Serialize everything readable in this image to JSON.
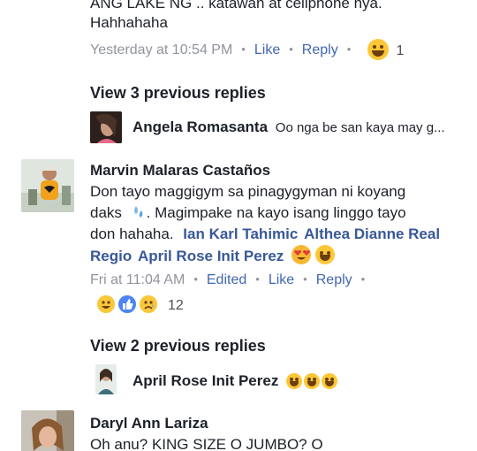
{
  "comment_top": {
    "text_line1": "ANG LAKE NG .. katawan at celiphone nya.",
    "text_line2": "Hahhahaha",
    "time": "Yesterday at 10:54 PM",
    "like": "Like",
    "reply": "Reply",
    "reaction_count": "1"
  },
  "replies_1": {
    "view_previous": "View 3 previous replies",
    "author": "Angela Romasanta",
    "preview": "Oo nga be san kaya may g..."
  },
  "comment_marvin": {
    "author": "Marvin Malaras Castaños",
    "line1": "Don tayo maggigym sa pinagygyman ni koyang",
    "line2_a": "daks",
    "line2_b": ". Magimpake na kayo isang linggo tayo",
    "line3_a": "don hahaha.",
    "tag1": "Ian Karl Tahimic",
    "tag2": "Althea Dianne Real",
    "tag3": "Regio",
    "tag4": "April Rose Init Perez",
    "time": "Fri at 11:04 AM",
    "edited": "Edited",
    "like": "Like",
    "reply": "Reply",
    "reaction_count": "12"
  },
  "replies_2": {
    "view_previous": "View 2 previous replies",
    "author": "April Rose Init Perez"
  },
  "comment_daryl": {
    "author": "Daryl Ann Lariza",
    "line1": "Oh anu? KING SIZE O JUMBO? O"
  },
  "colors": {
    "link": "#385898",
    "meta": "#90949c",
    "action": "#4267b2"
  }
}
